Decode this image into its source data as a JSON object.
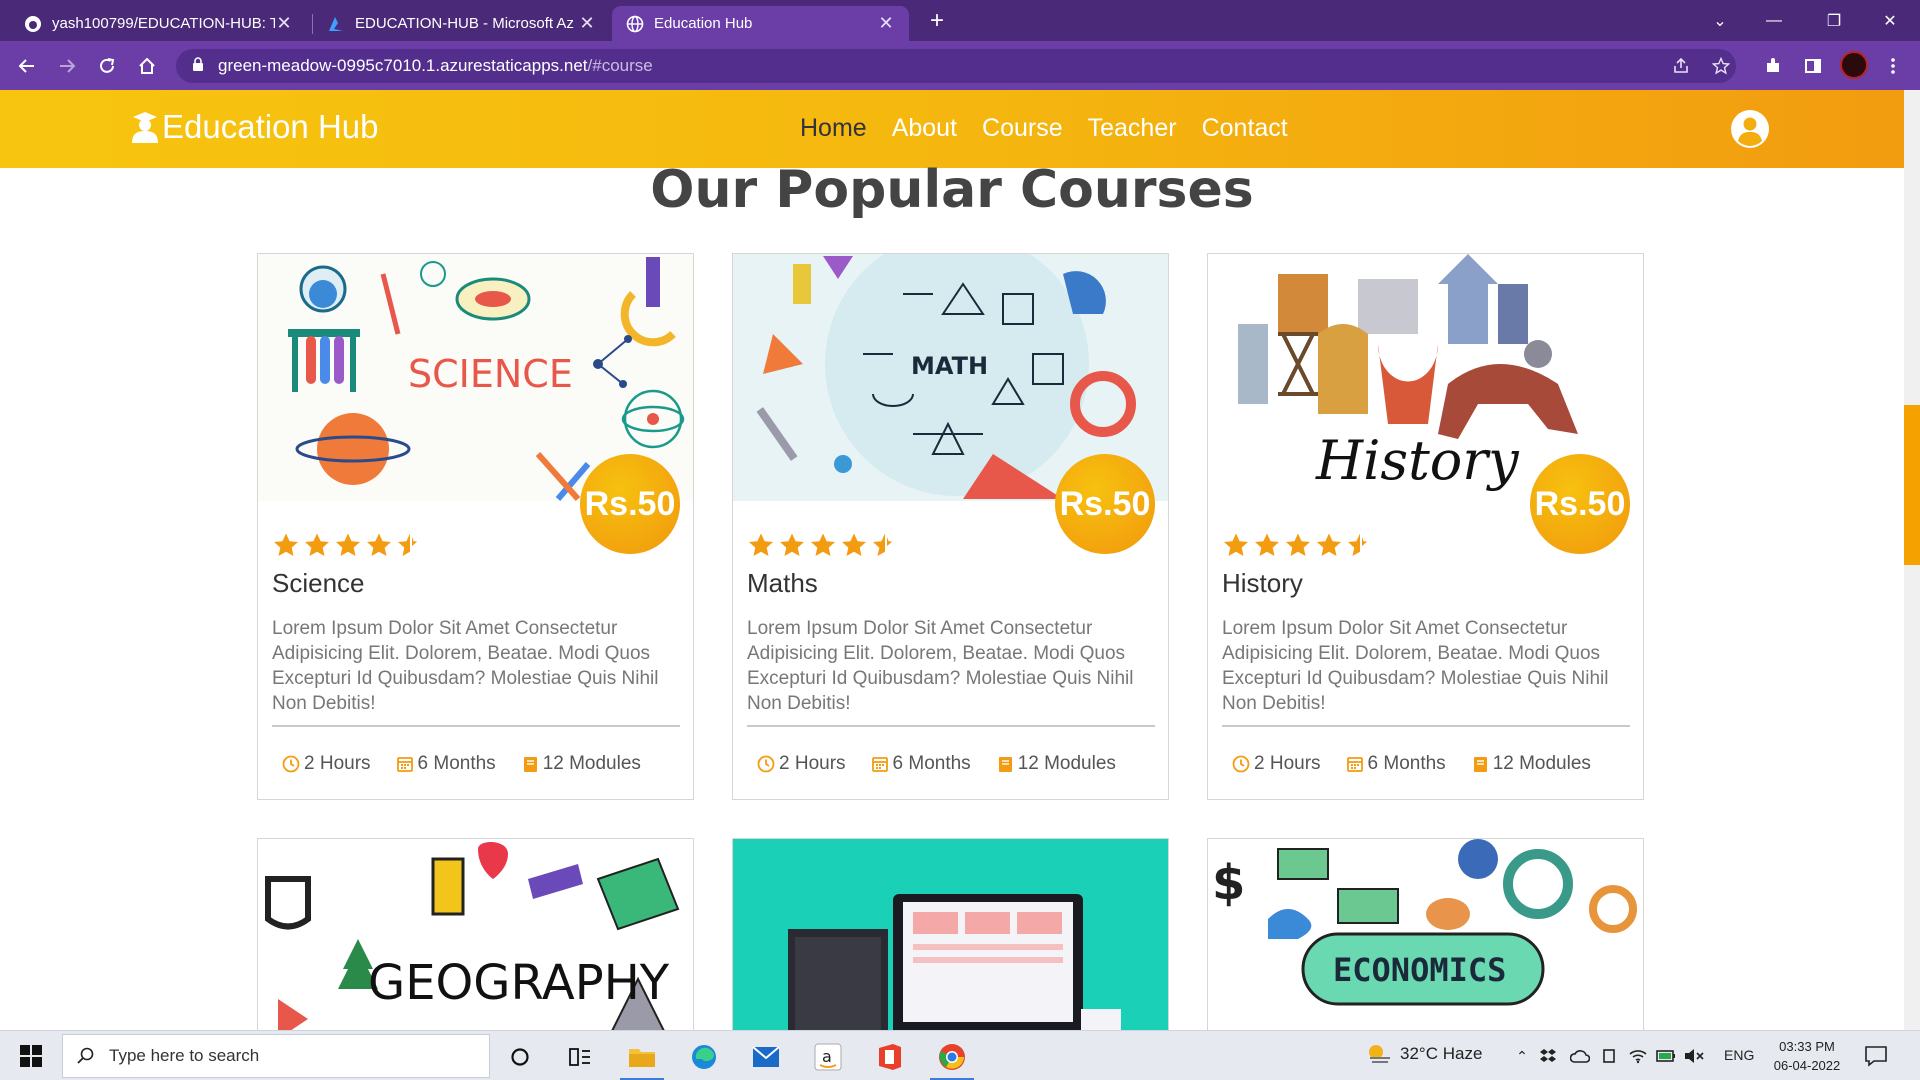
{
  "browser": {
    "tabs": [
      {
        "title": "yash100799/EDUCATION-HUB: T",
        "icon": "github-icon"
      },
      {
        "title": "EDUCATION-HUB - Microsoft Az",
        "icon": "azure-icon"
      },
      {
        "title": "Education Hub",
        "icon": "globe-icon",
        "active": true
      }
    ],
    "url_host": "green-meadow-0995c7010.1.azurestaticapps.net",
    "url_path": "/#course"
  },
  "site": {
    "logo_text": "Education Hub",
    "nav": [
      "Home",
      "About",
      "Course",
      "Teacher",
      "Contact"
    ],
    "active_nav": "Home",
    "section_title": "Our Popular Courses"
  },
  "courses": [
    {
      "name": "Science",
      "price": "Rs.50",
      "rating": 4.5,
      "description": "Lorem Ipsum Dolor Sit Amet Consectetur Adipisicing Elit. Dolorem, Beatae. Modi Quos Excepturi Id Quibusdam? Molestiae Quis Nihil Non Debitis!",
      "hours": "2 Hours",
      "months": "6 Months",
      "modules": "12 Modules",
      "image_label": "SCIENCE"
    },
    {
      "name": "Maths",
      "price": "Rs.50",
      "rating": 4.5,
      "description": "Lorem Ipsum Dolor Sit Amet Consectetur Adipisicing Elit. Dolorem, Beatae. Modi Quos Excepturi Id Quibusdam? Molestiae Quis Nihil Non Debitis!",
      "hours": "2 Hours",
      "months": "6 Months",
      "modules": "12 Modules",
      "image_label": "MATH"
    },
    {
      "name": "History",
      "price": "Rs.50",
      "rating": 4.5,
      "description": "Lorem Ipsum Dolor Sit Amet Consectetur Adipisicing Elit. Dolorem, Beatae. Modi Quos Excepturi Id Quibusdam? Molestiae Quis Nihil Non Debitis!",
      "hours": "2 Hours",
      "months": "6 Months",
      "modules": "12 Modules",
      "image_label": "History"
    }
  ],
  "partial_courses": [
    {
      "image_label": "GEOGRAPHY"
    },
    {
      "image_label": ""
    },
    {
      "image_label": "ECONOMICS"
    }
  ],
  "colors": {
    "accent": "#f5b70f",
    "browser": "#6a3ea6",
    "star": "#f39c12"
  },
  "taskbar": {
    "search_placeholder": "Type here to search",
    "weather": "32°C  Haze",
    "lang": "ENG",
    "time": "03:33 PM",
    "date": "06-04-2022"
  }
}
